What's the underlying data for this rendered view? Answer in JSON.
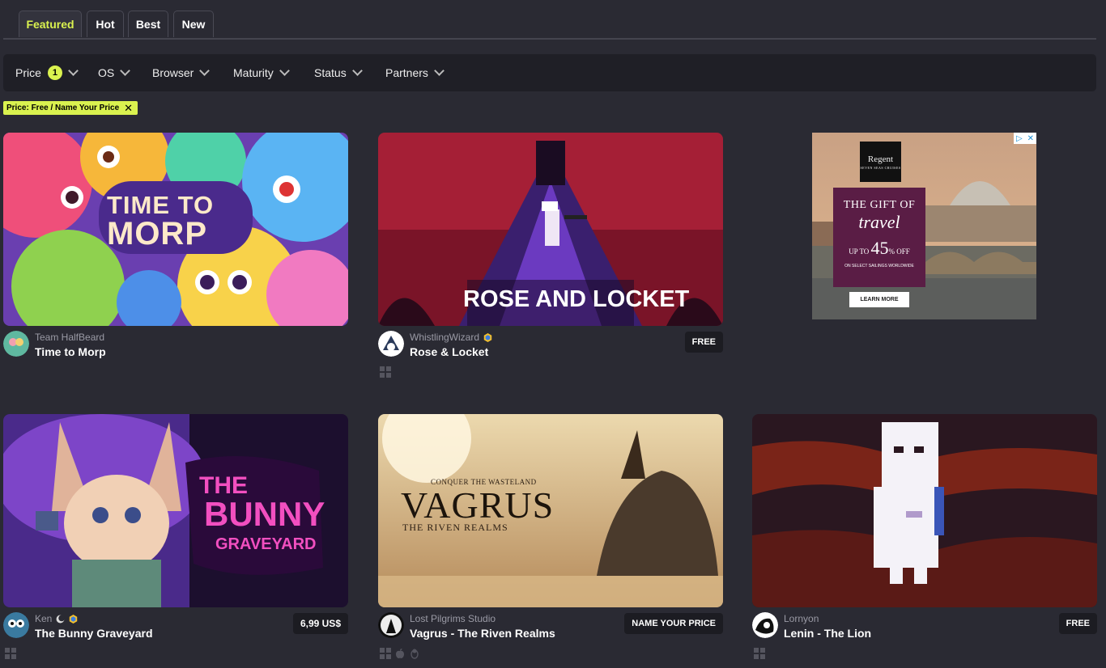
{
  "tabs": [
    "Featured",
    "Hot",
    "Best",
    "New"
  ],
  "filters": {
    "price": "Price",
    "price_count": "1",
    "os": "OS",
    "browser": "Browser",
    "maturity": "Maturity",
    "status": "Status",
    "partners": "Partners"
  },
  "active_filter": "Price: Free / Name Your Price",
  "games": [
    {
      "author": "Team HalfBeard",
      "title": "Time to Morp",
      "price": "",
      "art_text": "TIME TO MORP",
      "platforms": []
    },
    {
      "author": "WhistlingWizard",
      "title": "Rose & Locket",
      "price": "FREE",
      "art_text": "ROSE AND LOCKET",
      "platforms": [
        "windows-icon"
      ]
    },
    {
      "author": "Ken",
      "title": "The Bunny Graveyard",
      "price": "6,99 US$",
      "art_text_1": "THE",
      "art_text_2": "BUNNY",
      "art_text_3": "GRAVEYARD",
      "platforms": [
        "windows-icon"
      ]
    },
    {
      "author": "Lost Pilgrims Studio",
      "title": "Vagrus - The Riven Realms",
      "price": "NAME YOUR PRICE",
      "art_tagline": "CONQUER THE WASTELAND",
      "art_text": "VAGRUS",
      "art_sub": "THE RIVEN REALMS",
      "platforms": [
        "windows-icon",
        "apple-icon",
        "linux-icon"
      ]
    },
    {
      "author": "Lornyon",
      "title": "Lenin - The Lion",
      "price": "FREE",
      "platforms": [
        "windows-icon"
      ]
    }
  ],
  "ad": {
    "logo": "Regent",
    "logo_sub": "SEVEN SEAS CRUISES",
    "headline": "THE GIFT OF",
    "script": "travel",
    "upto": "UP TO",
    "pct": "45",
    "off": "% OFF",
    "note": "ON SELECT SAILINGS WORLDWIDE",
    "cta": "LEARN MORE"
  },
  "colors": {
    "accent": "#daf24f",
    "bg": "#2a2a33",
    "bar": "#1f1f26"
  }
}
